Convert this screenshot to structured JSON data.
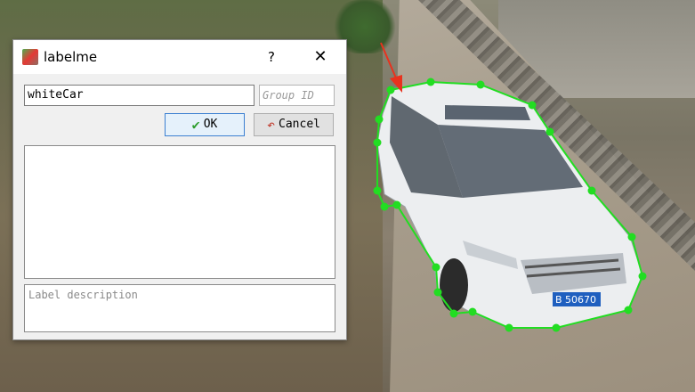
{
  "dialog": {
    "title": "labelme",
    "help": "?",
    "close": "✕",
    "label_value": "whiteCar",
    "group_id_placeholder": "Group ID",
    "ok_label": "OK",
    "cancel_label": "Cancel",
    "description_placeholder": "Label description"
  },
  "annotation": {
    "polygon_color": "#22dd22",
    "arrow_color": "#e8321e",
    "plate_text": "B 50670"
  }
}
